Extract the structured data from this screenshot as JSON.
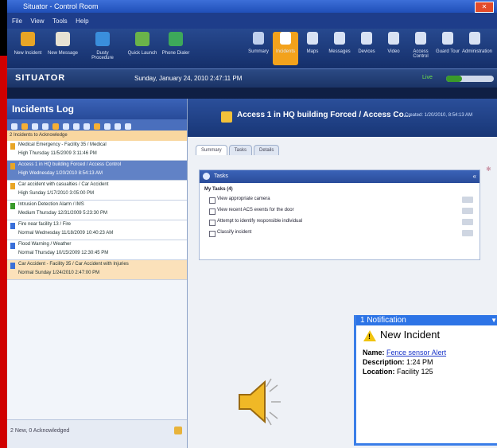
{
  "window": {
    "title": "Situator - Control Room"
  },
  "menu": [
    "File",
    "View",
    "Tools",
    "Help"
  ],
  "toolbar": {
    "left": [
      {
        "label": "New Incident",
        "color": "#e8a526"
      },
      {
        "label": "New Message",
        "color": "#e7e2d3"
      },
      {
        "label": "Dusty Procedure",
        "color": "#3a8edc"
      },
      {
        "label": "Quick Launch",
        "color": "#6ab34a"
      },
      {
        "label": "Phone Dialer",
        "color": "#3da85a"
      }
    ],
    "right": [
      {
        "label": "Summary",
        "color": "#bfd0ee",
        "active": false
      },
      {
        "label": "Incidents",
        "color": "#ffffff",
        "active": true
      },
      {
        "label": "Maps",
        "color": "#d8e2f4",
        "active": false
      },
      {
        "label": "Messages",
        "color": "#d8e2f4",
        "active": false
      },
      {
        "label": "Devices",
        "color": "#d8e2f4",
        "active": false
      },
      {
        "label": "Video",
        "color": "#d8e2f4",
        "active": false
      },
      {
        "label": "Access Control",
        "color": "#d8e2f4",
        "active": false
      },
      {
        "label": "Guard Tour",
        "color": "#d8e2f4",
        "active": false
      },
      {
        "label": "Administration",
        "color": "#d8e2f4",
        "active": false
      }
    ]
  },
  "status": {
    "logo": "SITUATOR",
    "datetime": "Sunday, January 24, 2010 2:47:11 PM",
    "live": "Live"
  },
  "incidents_log": {
    "title": "Incidents Log",
    "subheader": "2 Incidents to Acknowledge",
    "rows": [
      {
        "title": "Medical Emergency - Facility 35 / Medical",
        "priority": "High",
        "time": "Thursday 11/5/2009 3:11:46 PM",
        "flag": "#e8a526",
        "style": "normal"
      },
      {
        "title": "Access 1 in HQ building Forced / Access Control",
        "priority": "High",
        "time": "Wednesday 1/20/2010 8:54:13 AM",
        "flag": "#e8a526",
        "style": "sel"
      },
      {
        "title": "Car accident with casualties / Car Accident",
        "priority": "High",
        "time": "Sunday 1/17/2010 3:05:00 PM",
        "flag": "#e8a526",
        "style": "normal"
      },
      {
        "title": "Intrusion Detection Alarm / IMS",
        "priority": "Medium",
        "time": "Thursday 12/31/2009 5:23:30 PM",
        "flag": "#3a9a2a",
        "style": "normal"
      },
      {
        "title": "Fire near facility 13 / Fire",
        "priority": "Normal",
        "time": "Wednesday 11/18/2009 10:40:23 AM",
        "flag": "#3a6fd8",
        "style": "normal"
      },
      {
        "title": "Flood Warning / Weather",
        "priority": "Normal",
        "time": "Thursday 10/15/2009 12:30:45 PM",
        "flag": "#3a6fd8",
        "style": "normal"
      },
      {
        "title": "Car Accident - Facility 35 / Car Accident with Injuries",
        "priority": "Normal",
        "time": "Sunday 1/24/2010 2:47:00 PM",
        "flag": "#3a6fd8",
        "style": "orange"
      }
    ],
    "footer": "2 New, 0 Acknowledged"
  },
  "incident": {
    "title": "Access 1 in HQ building Forced / Access Co...",
    "subtitle": "Created: 1/20/2010, 8:54:13 AM",
    "tabs": [
      "Summary",
      "Tasks",
      "Details"
    ],
    "tasks_header": "Tasks",
    "my_tasks": "My Tasks (4)",
    "tasks": [
      "View appropriate camera",
      "View recent ACS events for the door",
      "Attempt to identify responsible individual",
      "Classify incident"
    ]
  },
  "notification": {
    "header": "1 Notification",
    "title": "New Incident",
    "name_label": "Name:",
    "name_value": "Fence sensor Alert",
    "description_label": "Description:",
    "description_value": "1:24 PM",
    "location_label": "Location:",
    "location_value": "Facility 125"
  },
  "colors": {
    "accent_orange": "#f3a21c",
    "header_blue": "#284b99",
    "notification_blue": "#2d74e6",
    "left_edge_red": "#d00000"
  }
}
